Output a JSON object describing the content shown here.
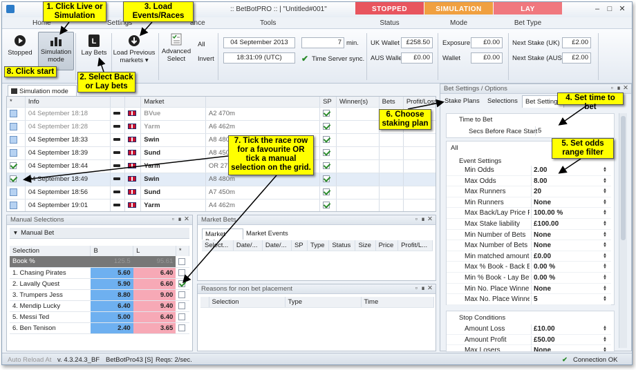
{
  "window": {
    "title": ":: BetBotPRO :: | \"Untitled#001\""
  },
  "topbands": [
    {
      "label": "STOPPED",
      "sub": "Status",
      "color": "#e8555e"
    },
    {
      "label": "SIMULATION",
      "sub": "Mode",
      "color": "#f0a040"
    },
    {
      "label": "LAY",
      "sub": "Bet Type",
      "color": "#f0787e"
    }
  ],
  "tabs": {
    "home": "Home",
    "settings": "Settings",
    "ance": "ance",
    "tools": "Tools"
  },
  "ribbon": {
    "stopped": "Stopped",
    "simulation_mode": "Simulation mode",
    "lay_bets": "Lay Bets",
    "load_previous_markets": "Load Previous markets",
    "advanced_select": "Advanced Select",
    "all": "All",
    "invert": "Invert",
    "date": "04 September 2013",
    "time": "18:31:09 (UTC)",
    "minutes": "7",
    "min_label": "min.",
    "time_server": "Time Server sync.",
    "uk_wallet_label": "UK Wallet",
    "uk_wallet": "£258.50",
    "aus_wallet_label": "AUS Wallet",
    "aus_wallet": "£0.00",
    "exposure_label": "Exposure",
    "exposure": "£0.00",
    "wallet_label": "Wallet",
    "wallet": "£0.00",
    "next_stake_uk_label": "Next Stake (UK)",
    "next_stake_uk": "£2.00",
    "next_stake_aus_label": "Next Stake (AUS)",
    "next_stake_aus": "£2.00"
  },
  "doc_tab": "Simulation mode",
  "market_grid": {
    "headers": [
      "*",
      "Info",
      "Market",
      "SP",
      "Winner(s)",
      "Bets",
      "Profit/Loss"
    ],
    "rows": [
      {
        "info": "04 September 18:18",
        "venue": "BVue",
        "race": "A2 470m",
        "sp": true,
        "checked": false,
        "past": true
      },
      {
        "info": "04 September 18:28",
        "venue": "Yarm",
        "race": "A6 462m",
        "sp": true,
        "checked": false,
        "past": true
      },
      {
        "info": "04 September 18:33",
        "venue": "Swin",
        "race": "A8 480m",
        "sp": true,
        "checked": false,
        "past": false
      },
      {
        "info": "04 September 18:39",
        "venue": "Sund",
        "race": "A8 450m",
        "sp": true,
        "checked": false,
        "past": false
      },
      {
        "info": "04 September 18:44",
        "venue": "Yarm",
        "race": "OR 277m",
        "sp": true,
        "checked": true,
        "past": false
      },
      {
        "info": "04 September 18:49",
        "venue": "Swin",
        "race": "A8 480m",
        "sp": true,
        "checked": true,
        "past": false
      },
      {
        "info": "04 September 18:56",
        "venue": "Sund",
        "race": "A7 450m",
        "sp": true,
        "checked": false,
        "past": false
      },
      {
        "info": "04 September 19:01",
        "venue": "Yarm",
        "race": "A4 462m",
        "sp": true,
        "checked": false,
        "past": false
      }
    ]
  },
  "manual_selections": {
    "title": "Manual Selections",
    "group": "Manual Bet",
    "headers": [
      "Selection",
      "B",
      "L",
      "*"
    ],
    "book": {
      "label": "Book %",
      "b": "125.5",
      "l": "95.61"
    },
    "rows": [
      {
        "name": "1. Chasing Pirates",
        "b": "5.60",
        "l": "6.40",
        "checked": false
      },
      {
        "name": "2. Lavally Quest",
        "b": "5.90",
        "l": "6.60",
        "checked": true
      },
      {
        "name": "3. Trumpers Jess",
        "b": "8.80",
        "l": "9.00",
        "checked": false
      },
      {
        "name": "4. Mendip Lucky",
        "b": "6.40",
        "l": "9.40",
        "checked": false
      },
      {
        "name": "5. Messi Ted",
        "b": "5.00",
        "l": "6.40",
        "checked": false
      },
      {
        "name": "6. Ben Tenison",
        "b": "2.40",
        "l": "3.65",
        "checked": false
      }
    ]
  },
  "market_bets": {
    "title": "Market Bets",
    "tabs": [
      "Market Bets",
      "Market Events"
    ],
    "headers": [
      "Select...",
      "Date/...",
      "Date/...",
      "SP",
      "Type",
      "Status",
      "Size",
      "Price",
      "Profit/L..."
    ]
  },
  "reasons": {
    "title": "Reasons for non bet placement",
    "headers": [
      "Selection",
      "Type",
      "Time"
    ]
  },
  "bet_settings": {
    "title": "Bet Settings / Options",
    "tabs": [
      "Stake Plans",
      "Selections",
      "Bet Settings"
    ],
    "time_to_bet": "Time to Bet",
    "secs_label": "Secs Before Race Start",
    "secs_value": "5",
    "filter": "All",
    "event_settings": "Event Settings",
    "rows": [
      {
        "k": "Min Odds",
        "v": "2.00"
      },
      {
        "k": "Max Odds",
        "v": "8.00"
      },
      {
        "k": "Max Runners",
        "v": "20"
      },
      {
        "k": "Min Runners",
        "v": "None"
      },
      {
        "k": "Max Back/Lay Price Ra",
        "v": "100.00 %"
      },
      {
        "k": "Max Stake liability",
        "v": "£100.00"
      },
      {
        "k": "Min Number of Bets",
        "v": "None"
      },
      {
        "k": "Max Number of Bets",
        "v": "None"
      },
      {
        "k": "Min matched amount",
        "v": "£0.00"
      },
      {
        "k": "Max % Book - Back Bet",
        "v": "0.00 %"
      },
      {
        "k": "Min % Book - Lay Bets",
        "v": "0.00 %"
      },
      {
        "k": "Min No. Place Winners",
        "v": "None"
      },
      {
        "k": "Max No. Place Winners",
        "v": "5"
      }
    ],
    "stop_conditions": "Stop Conditions",
    "stop_rows": [
      {
        "k": "Amount Loss",
        "v": "£10.00"
      },
      {
        "k": "Amount Profit",
        "v": "£50.00"
      },
      {
        "k": "Max Losers",
        "v": "None"
      }
    ]
  },
  "statusbar": {
    "auto_reload": "Auto Reload At",
    "version": "v. 4.3.24.3_BF",
    "profile": "BetBotPro43 [S]",
    "reqs": "Reqs: 2/sec.",
    "connection": "Connection OK"
  },
  "annotations": {
    "a1": "1. Click Live or Simulation",
    "a2": "2. Select Back or Lay bets",
    "a3": "3. Load Events/Races",
    "a4": "4. Set time to bet",
    "a5": "5. Set odds range filter",
    "a6": "6. Choose staking plan",
    "a7": "7. Tick the race row for a favourite OR tick a manual selection on the grid.",
    "a8": "8. Click start"
  }
}
